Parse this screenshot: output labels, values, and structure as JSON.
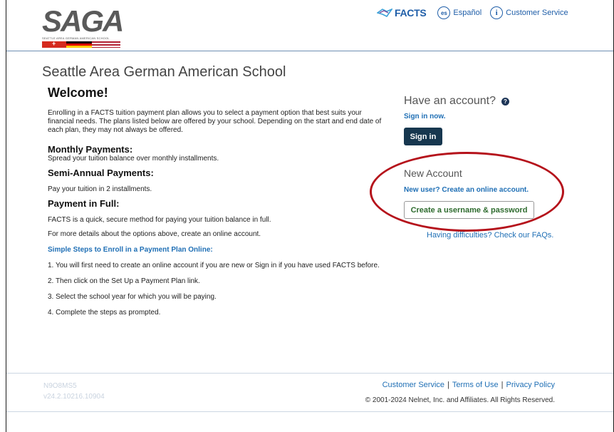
{
  "header": {
    "logo_text": "SAGA",
    "logo_subtext": "SEATTLE AREA GERMAN AMERICAN SCHOOL",
    "facts_brand": "FACTS",
    "spanish_badge": "es",
    "spanish_label": "Español",
    "info_badge": "i",
    "customer_service_label": "Customer Service"
  },
  "main": {
    "school_name": "Seattle Area German American School",
    "welcome_title": "Welcome!",
    "intro": "Enrolling in a FACTS tuition payment plan allows you to select a payment option that best suits your financial needs. The plans listed below are offered by your school. Depending on the start and end date of each plan, they may not always be offered.",
    "plans": [
      {
        "title": "Monthly Payments:",
        "description": "Spread your tuition balance over monthly installments."
      },
      {
        "title": "Semi-Annual Payments:",
        "description": "Pay your tuition in 2 installments."
      },
      {
        "title": "Payment in Full:",
        "description": "FACTS is a quick, secure method for paying your tuition balance in full."
      }
    ],
    "more_details": "For more details about the options above, create an online account.",
    "steps_title": "Simple Steps to Enroll in a Payment Plan Online:",
    "steps": [
      "1. You will first need to create an online account if you are new or Sign in if you have used FACTS before.",
      "2. Then click on the Set Up a Payment Plan link.",
      "3. Select the school year for which you will be paying.",
      "4. Complete the steps as prompted."
    ]
  },
  "sidebar": {
    "have_account": "Have an account?",
    "help_icon_glyph": "?",
    "sign_in_now": "Sign in now.",
    "sign_in_button": "Sign in",
    "new_account": "New Account",
    "new_user_link": "New user? Create an online account.",
    "create_button": "Create a username & password",
    "faq_link": "Having difficulties? Check our FAQs."
  },
  "footer": {
    "build_id": "N9O8MS5",
    "version": "v24.2.10216.10904",
    "links": [
      "Customer Service",
      "Terms of Use",
      "Privacy Policy"
    ],
    "separator": "|",
    "copyright": "© 2001-2024 Nelnet, Inc. and Affiliates. All Rights Reserved."
  },
  "colors": {
    "link_blue": "#1f6fb5",
    "sign_in_bg": "#17374f",
    "create_text": "#2e6b2e",
    "annotation_red": "#b5121b"
  }
}
